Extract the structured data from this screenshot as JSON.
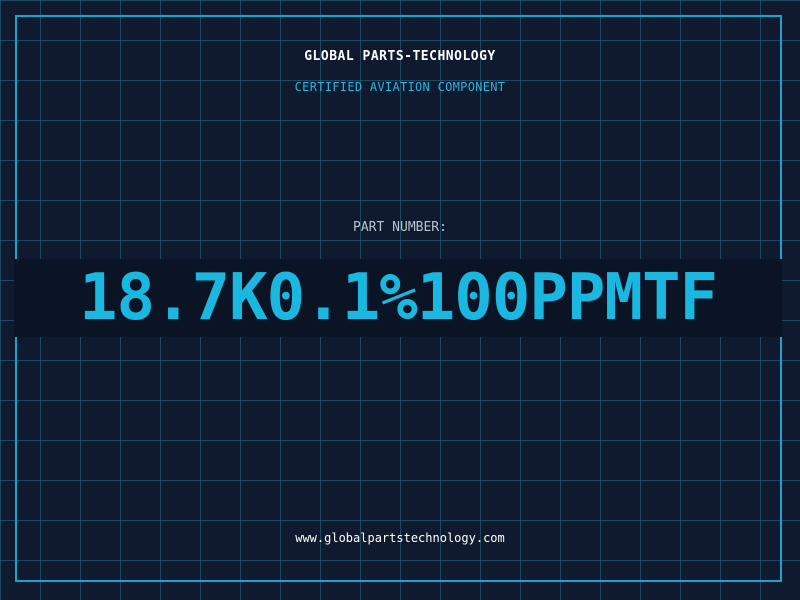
{
  "brand": "GLOBAL PARTS-TECHNOLOGY",
  "subtitle": "CERTIFIED AVIATION COMPONENT",
  "part": {
    "label": "PART NUMBER:",
    "value": "18.7K0.1%100PPMTF"
  },
  "footer": {
    "url": "www.globalpartstechnology.com"
  },
  "colors": {
    "background": "#0f1a2e",
    "grid": "#266e8c",
    "accent": "#1ab8e0",
    "text": "#ffffff"
  }
}
